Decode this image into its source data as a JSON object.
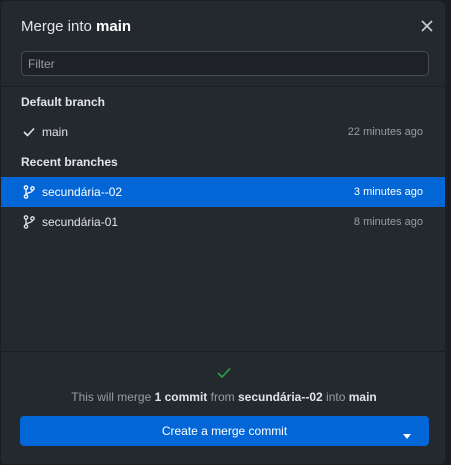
{
  "dialog": {
    "title_prefix": "Merge into",
    "title_branch": "main"
  },
  "filter": {
    "placeholder": "Filter",
    "value": ""
  },
  "groups": [
    {
      "label": "Default branch",
      "items": [
        {
          "name": "main",
          "time": "22 minutes ago",
          "icon": "check-icon",
          "selected": false
        }
      ]
    },
    {
      "label": "Recent branches",
      "items": [
        {
          "name": "secundária--02",
          "time": "3 minutes ago",
          "icon": "branch-icon",
          "selected": true
        },
        {
          "name": "secundária-01",
          "time": "8 minutes ago",
          "icon": "branch-icon",
          "selected": false
        }
      ]
    }
  ],
  "footer": {
    "status_icon": "check-icon",
    "msg_pre": "This will merge",
    "msg_count": "1 commit",
    "msg_from": "from",
    "msg_source": "secundária--02",
    "msg_into": "into",
    "msg_target": "main",
    "button_label": "Create a merge commit"
  },
  "colors": {
    "accent": "#0366d6",
    "success": "#28a745",
    "background": "#24292e"
  }
}
